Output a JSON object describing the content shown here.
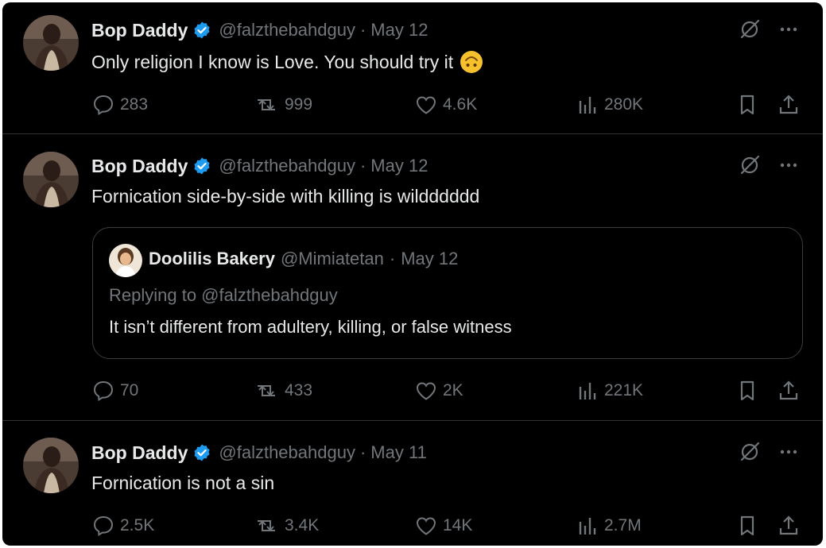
{
  "theme": {
    "background": "#000000",
    "text": "#e7e9ea",
    "muted": "#71767b",
    "verified": "#1d9bf0",
    "divider": "#2f3336"
  },
  "tweets": [
    {
      "author": {
        "name": "Bop Daddy",
        "handle": "@falzthebahdguy",
        "verified": true
      },
      "separator": "·",
      "date": "May 12",
      "text": "Only religion I know is Love. You should try it",
      "emoji": "upside-down-face",
      "stats": {
        "replies": "283",
        "reposts": "999",
        "likes": "4.6K",
        "views": "280K"
      }
    },
    {
      "author": {
        "name": "Bop Daddy",
        "handle": "@falzthebahdguy",
        "verified": true
      },
      "separator": "·",
      "date": "May 12",
      "text": "Fornication side-by-side with killing is wildddddd",
      "quote": {
        "name": "Doolilis Bakery",
        "handle": "@Mimiatetan",
        "separator": "·",
        "date": "May 12",
        "replying_to": "Replying to @falzthebahdguy",
        "text": "It isn’t different from adultery, killing, or false witness"
      },
      "stats": {
        "replies": "70",
        "reposts": "433",
        "likes": "2K",
        "views": "221K"
      }
    },
    {
      "author": {
        "name": "Bop Daddy",
        "handle": "@falzthebahdguy",
        "verified": true
      },
      "separator": "·",
      "date": "May 11",
      "text": "Fornication is not a sin",
      "stats": {
        "replies": "2.5K",
        "reposts": "3.4K",
        "likes": "14K",
        "views": "2.7M"
      }
    }
  ],
  "icons": {
    "grok": "grok-icon",
    "more": "more-icon",
    "reply": "reply-icon",
    "repost": "repost-icon",
    "like": "like-icon",
    "views": "views-icon",
    "bookmark": "bookmark-icon",
    "share": "share-icon",
    "verified": "verified-badge-icon"
  }
}
